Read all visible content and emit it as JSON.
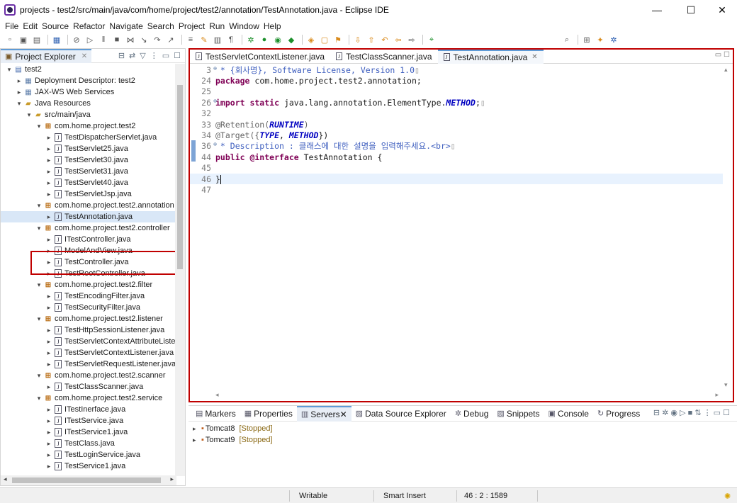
{
  "window": {
    "title": "projects - test2/src/main/java/com/home/project/test2/annotation/TestAnnotation.java - Eclipse IDE",
    "minimize": "—",
    "maximize": "☐",
    "close": "✕"
  },
  "menu": [
    "File",
    "Edit",
    "Source",
    "Refactor",
    "Navigate",
    "Search",
    "Project",
    "Run",
    "Window",
    "Help"
  ],
  "explorer": {
    "tab_label": "Project Explorer",
    "tree": [
      {
        "depth": 0,
        "arrow": "▾",
        "icon": "project-icon",
        "label": "test2"
      },
      {
        "depth": 1,
        "arrow": "▸",
        "icon": "web-icon",
        "label": "Deployment Descriptor: test2"
      },
      {
        "depth": 1,
        "arrow": "▸",
        "icon": "web-icon",
        "label": "JAX-WS Web Services"
      },
      {
        "depth": 1,
        "arrow": "▾",
        "icon": "folder-icon",
        "label": "Java Resources"
      },
      {
        "depth": 2,
        "arrow": "▾",
        "icon": "folder-icon",
        "label": "src/main/java"
      },
      {
        "depth": 3,
        "arrow": "▾",
        "icon": "package-icon",
        "label": "com.home.project.test2"
      },
      {
        "depth": 4,
        "arrow": "▸",
        "icon": "java-file-icon",
        "label": "TestDispatcherServlet.java"
      },
      {
        "depth": 4,
        "arrow": "▸",
        "icon": "java-file-icon",
        "label": "TestServlet25.java"
      },
      {
        "depth": 4,
        "arrow": "▸",
        "icon": "java-file-icon",
        "label": "TestServlet30.java"
      },
      {
        "depth": 4,
        "arrow": "▸",
        "icon": "java-file-icon",
        "label": "TestServlet31.java"
      },
      {
        "depth": 4,
        "arrow": "▸",
        "icon": "java-file-icon",
        "label": "TestServlet40.java"
      },
      {
        "depth": 4,
        "arrow": "▸",
        "icon": "java-file-icon",
        "label": "TestServletJsp.java"
      },
      {
        "depth": 3,
        "arrow": "▾",
        "icon": "package-icon",
        "label": "com.home.project.test2.annotation"
      },
      {
        "depth": 4,
        "arrow": "▸",
        "icon": "java-file-icon",
        "label": "TestAnnotation.java",
        "selected": true
      },
      {
        "depth": 3,
        "arrow": "▾",
        "icon": "package-icon",
        "label": "com.home.project.test2.controller"
      },
      {
        "depth": 4,
        "arrow": "▸",
        "icon": "java-file-icon",
        "label": "ITestController.java"
      },
      {
        "depth": 4,
        "arrow": "▸",
        "icon": "java-file-icon",
        "label": "ModelAndView.java"
      },
      {
        "depth": 4,
        "arrow": "▸",
        "icon": "java-file-icon",
        "label": "TestController.java"
      },
      {
        "depth": 4,
        "arrow": "▸",
        "icon": "java-file-icon",
        "label": "TestRootController.java"
      },
      {
        "depth": 3,
        "arrow": "▾",
        "icon": "package-icon",
        "label": "com.home.project.test2.filter"
      },
      {
        "depth": 4,
        "arrow": "▸",
        "icon": "java-file-icon",
        "label": "TestEncodingFilter.java"
      },
      {
        "depth": 4,
        "arrow": "▸",
        "icon": "java-file-icon",
        "label": "TestSecurityFilter.java"
      },
      {
        "depth": 3,
        "arrow": "▾",
        "icon": "package-icon",
        "label": "com.home.project.test2.listener"
      },
      {
        "depth": 4,
        "arrow": "▸",
        "icon": "java-file-icon",
        "label": "TestHttpSessionListener.java"
      },
      {
        "depth": 4,
        "arrow": "▸",
        "icon": "java-file-icon",
        "label": "TestServletContextAttributeListe"
      },
      {
        "depth": 4,
        "arrow": "▸",
        "icon": "java-file-icon",
        "label": "TestServletContextListener.java"
      },
      {
        "depth": 4,
        "arrow": "▸",
        "icon": "java-file-icon",
        "label": "TestServletRequestListener.java"
      },
      {
        "depth": 3,
        "arrow": "▾",
        "icon": "package-icon",
        "label": "com.home.project.test2.scanner"
      },
      {
        "depth": 4,
        "arrow": "▸",
        "icon": "java-file-icon",
        "label": "TestClassScanner.java"
      },
      {
        "depth": 3,
        "arrow": "▾",
        "icon": "package-icon",
        "label": "com.home.project.test2.service"
      },
      {
        "depth": 4,
        "arrow": "▸",
        "icon": "java-file-icon",
        "label": "ITestInerface.java"
      },
      {
        "depth": 4,
        "arrow": "▸",
        "icon": "java-file-icon",
        "label": "ITestService.java"
      },
      {
        "depth": 4,
        "arrow": "▸",
        "icon": "java-file-icon",
        "label": "ITestService1.java"
      },
      {
        "depth": 4,
        "arrow": "▸",
        "icon": "java-file-icon",
        "label": "TestClass.java"
      },
      {
        "depth": 4,
        "arrow": "▸",
        "icon": "java-file-icon",
        "label": "TestLoginService.java"
      },
      {
        "depth": 4,
        "arrow": "▸",
        "icon": "java-file-icon",
        "label": "TestService1.java"
      }
    ]
  },
  "editor": {
    "tabs": [
      {
        "label": "TestServletContextListener.java",
        "active": false
      },
      {
        "label": "TestClassScanner.java",
        "active": false
      },
      {
        "label": "TestAnnotation.java",
        "active": true
      }
    ],
    "lines": [
      {
        "n": "3",
        "fold": "⊕",
        "parts": [
          [
            "cm",
            " * {회사명}, Software License, Version 1.0"
          ],
          [
            "box",
            "▯"
          ]
        ]
      },
      {
        "n": "24",
        "fold": "",
        "parts": [
          [
            "kw",
            "package"
          ],
          [
            "",
            " com.home.project.test2.annotation;"
          ]
        ]
      },
      {
        "n": "25",
        "fold": "",
        "parts": []
      },
      {
        "n": "26",
        "fold": "⊕",
        "parts": [
          [
            "kw",
            "import static"
          ],
          [
            "",
            " java.lang.annotation.ElementType."
          ],
          [
            "cst",
            "METHOD"
          ],
          [
            "",
            ";"
          ],
          [
            "box",
            "▯"
          ]
        ]
      },
      {
        "n": "32",
        "fold": "",
        "parts": []
      },
      {
        "n": "33",
        "fold": "",
        "parts": [
          [
            "ann",
            "@Retention("
          ],
          [
            "cst",
            "RUNTIME"
          ],
          [
            "ann",
            ")"
          ]
        ]
      },
      {
        "n": "34",
        "fold": "",
        "parts": [
          [
            "ann",
            "@Target({"
          ],
          [
            "cst",
            "TYPE"
          ],
          [
            "",
            ", "
          ],
          [
            "cst",
            "METHOD"
          ],
          [
            "",
            "})"
          ]
        ]
      },
      {
        "n": "36",
        "fold": "⊕",
        "parts": [
          [
            "cm",
            " * Description : 클래스에 대한 설명을 입력해주세요.<br>"
          ],
          [
            "box",
            "▯"
          ]
        ]
      },
      {
        "n": "44",
        "fold": "",
        "parts": [
          [
            "kw",
            "public @interface"
          ],
          [
            "",
            " TestAnnotation {"
          ]
        ]
      },
      {
        "n": "45",
        "fold": "",
        "parts": []
      },
      {
        "n": "46",
        "fold": "",
        "parts": [
          [
            "",
            "}"
          ]
        ],
        "current": true
      },
      {
        "n": "47",
        "fold": "",
        "parts": []
      }
    ]
  },
  "bottom": {
    "tabs": [
      {
        "label": "Markers",
        "icon": "markers-icon",
        "active": false
      },
      {
        "label": "Properties",
        "icon": "properties-icon",
        "active": false
      },
      {
        "label": "Servers",
        "icon": "servers-icon",
        "active": true
      },
      {
        "label": "Data Source Explorer",
        "icon": "database-icon",
        "active": false
      },
      {
        "label": "Debug",
        "icon": "debug-icon",
        "active": false
      },
      {
        "label": "Snippets",
        "icon": "snippets-icon",
        "active": false
      },
      {
        "label": "Console",
        "icon": "console-icon",
        "active": false
      },
      {
        "label": "Progress",
        "icon": "progress-icon",
        "active": false
      }
    ],
    "servers": [
      {
        "name": "Tomcat8",
        "state": "[Stopped]"
      },
      {
        "name": "Tomcat9",
        "state": "[Stopped]"
      }
    ]
  },
  "status": {
    "writable": "Writable",
    "insert_mode": "Smart Insert",
    "position": "46 : 2 : 1589"
  },
  "colors": {
    "highlight_border": "#c00000",
    "keyword": "#7f0055",
    "comment": "#3f5fbf",
    "constant": "#0000c0"
  }
}
